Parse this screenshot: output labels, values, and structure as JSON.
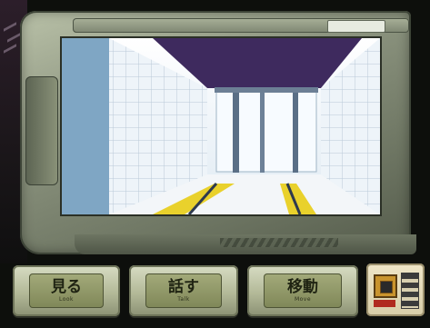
{
  "commands": [
    {
      "id": "look",
      "jp": "見る",
      "en": "Look"
    },
    {
      "id": "talk",
      "jp": "話す",
      "en": "Talk"
    },
    {
      "id": "move",
      "jp": "移動",
      "en": "Move"
    }
  ],
  "frame": {
    "badge_text": "",
    "label_text": ""
  },
  "colors": {
    "wall": "#e8f0f7",
    "ceiling": "#3e2a5e",
    "floor_stripe": "#e9d12c",
    "frame_metal": "#8d9580"
  },
  "icons": [
    "map-panel-icon",
    "slot-indicator-icon"
  ]
}
